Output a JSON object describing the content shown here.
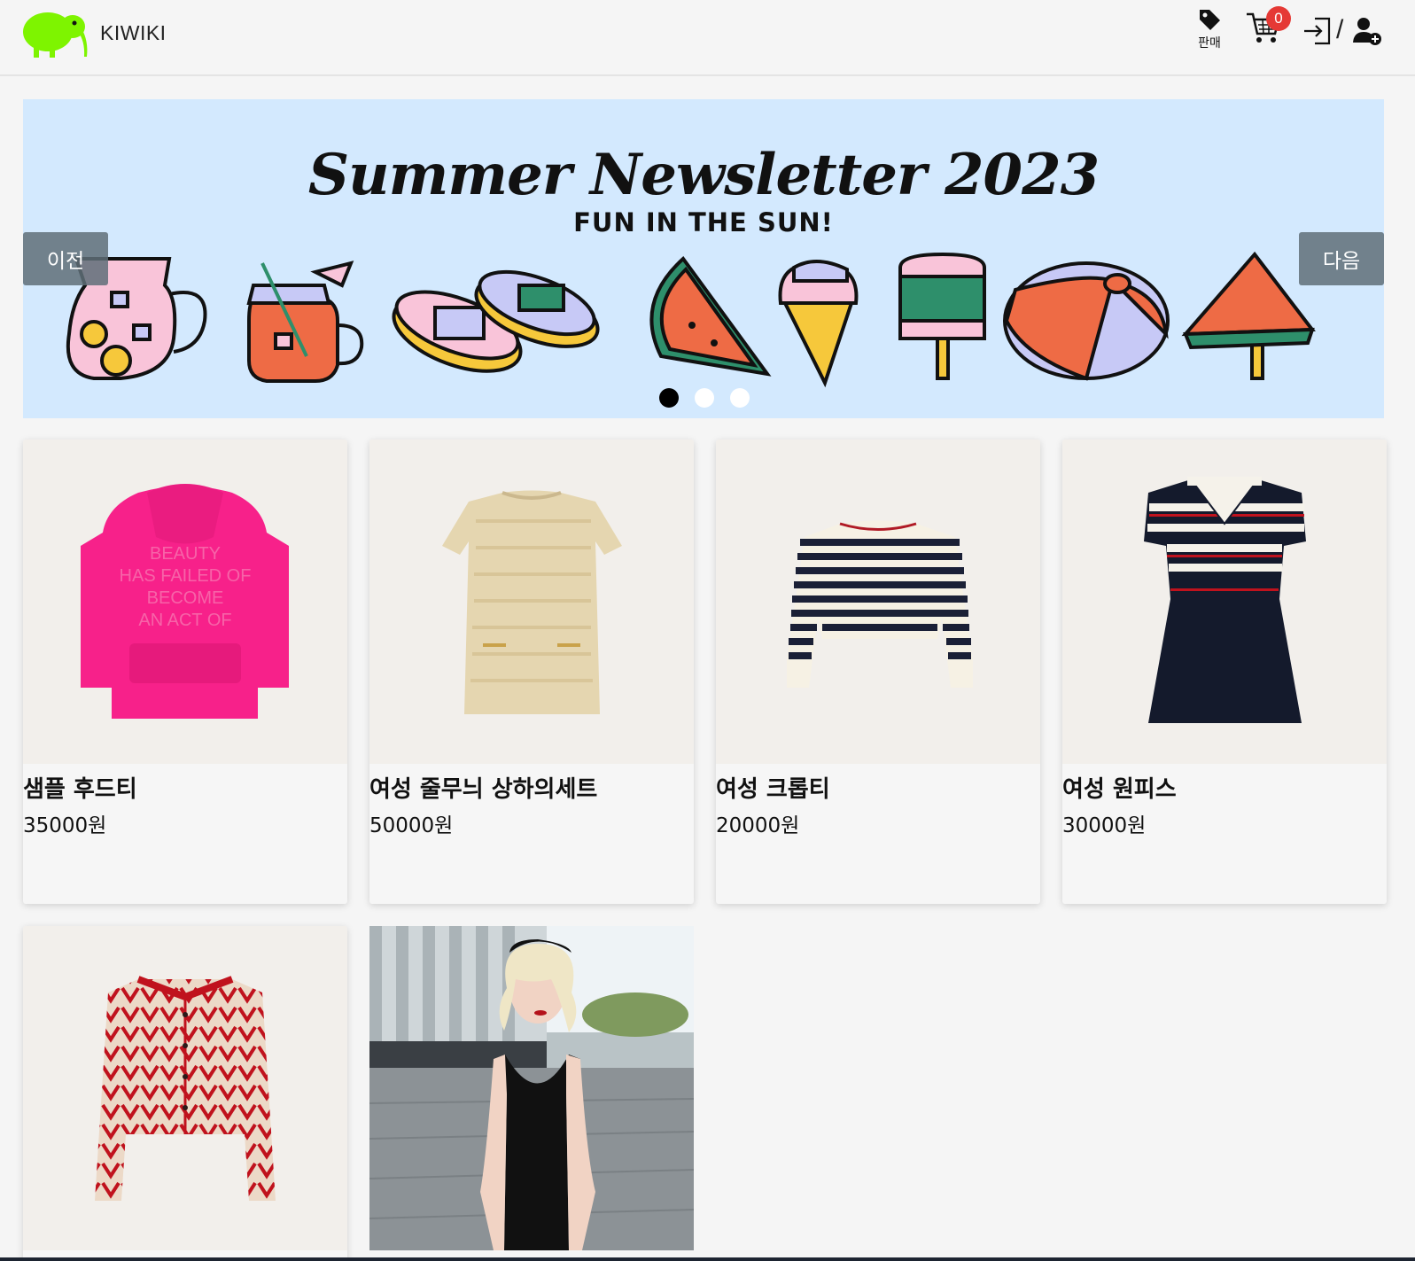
{
  "header": {
    "brand": "KIWIKI",
    "sell_label": "판매",
    "cart_count": "0",
    "separator": "/"
  },
  "banner": {
    "title": "Summer Newsletter 2023",
    "subtitle": "FUN IN THE SUN!",
    "prev_label": "이전",
    "next_label": "다음",
    "slides_count": 3,
    "active_slide": 1,
    "background": "#d3e9fe"
  },
  "products": [
    {
      "name": "샘플 후드티",
      "price": "35000원"
    },
    {
      "name": "여성 줄무늬 상하의세트",
      "price": "50000원"
    },
    {
      "name": "여성 크롭티",
      "price": "20000원"
    },
    {
      "name": "여성 원피스",
      "price": "30000원"
    },
    {
      "name": "",
      "price": ""
    },
    {
      "name": "",
      "price": ""
    }
  ],
  "colors": {
    "logo": "#7ef400",
    "badge": "#e53935",
    "page_bg": "#f5f5f5"
  },
  "icons": [
    "kiwi-logo-icon",
    "price-tag-icon",
    "cart-icon",
    "login-icon",
    "add-user-icon"
  ]
}
